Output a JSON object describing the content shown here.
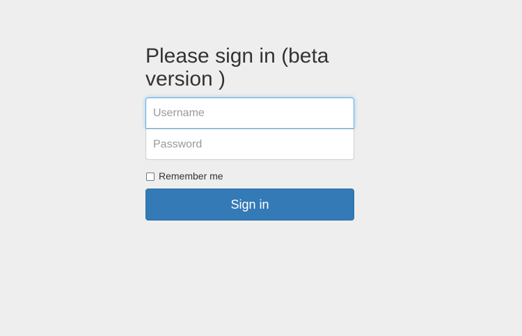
{
  "form": {
    "heading": "Please sign in (beta version )",
    "username": {
      "placeholder": "Username",
      "value": ""
    },
    "password": {
      "placeholder": "Password",
      "value": ""
    },
    "remember_label": "Remember me",
    "remember_checked": false,
    "submit_label": "Sign in"
  },
  "colors": {
    "background": "#eeeeee",
    "primary_button": "#337ab7",
    "focus_border": "#66afe9",
    "heading_text": "#333333"
  }
}
